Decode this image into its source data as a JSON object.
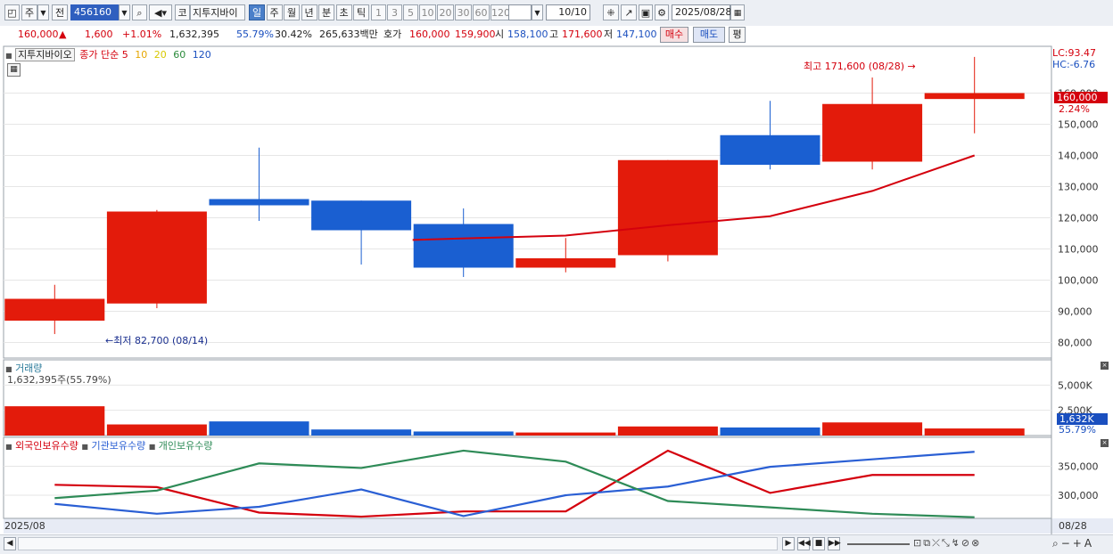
{
  "toolbar": {
    "type_label": "주",
    "prev_label": "전",
    "code": "456160",
    "stock_prefix": "코",
    "stock_name": "지투지바이",
    "periods": [
      "일",
      "주",
      "월",
      "년",
      "분",
      "초",
      "틱"
    ],
    "selected_period": "일",
    "intervals": [
      "1",
      "3",
      "5",
      "10",
      "20",
      "30",
      "60",
      "120"
    ],
    "count": "10/10",
    "date": "2025/08/28"
  },
  "quote": {
    "price": "160,000",
    "change": "1,600",
    "change_pct": "+1.01%",
    "volume": "1,632,395",
    "vol_ratio": "55.79%",
    "turnover_pct": "30.42%",
    "amount": "265,633백만",
    "hoga_label": "호가",
    "ask": "160,000",
    "bid": "159,900",
    "open_label": "시",
    "open": "158,100",
    "high_label": "고",
    "high": "171,600",
    "low_label": "저",
    "low": "147,100",
    "buy_label": "매수",
    "sell_label": "매도",
    "eval_label": "평"
  },
  "price_panel": {
    "stock_label": "지투지바이오",
    "legend_prefix": "종가 단순",
    "ma_periods": [
      "5",
      "10",
      "20",
      "60",
      "120"
    ],
    "ma_colors": [
      "#d4000d",
      "#e6a600",
      "#e6d200",
      "#2a8a3a",
      "#1a4fbf"
    ],
    "lc": "LC:93.47",
    "hc": "HC:-6.76",
    "current_tag": "160,000",
    "current_pct": "2.24%",
    "high_annot": "최고 171,600 (08/28)",
    "low_annot": "최저 82,700 (08/14)"
  },
  "volume_panel": {
    "title": "거래량",
    "value_text": "1,632,395주(55.79%)",
    "current_tag": "1,632K",
    "current_pct": "55.79%"
  },
  "holdings_panel": {
    "series_labels": [
      "외국인보유수량",
      "기관보유수량",
      "개인보유수량"
    ]
  },
  "x_axis": {
    "left_label": "2025/08",
    "right_label": "08/28"
  },
  "chart_data": [
    {
      "type": "candlestick",
      "ylim": [
        75000,
        175000
      ],
      "yticks": [
        80000,
        90000,
        100000,
        110000,
        120000,
        130000,
        140000,
        150000,
        160000
      ],
      "ytick_labels": [
        "80,000",
        "90,000",
        "100,000",
        "110,000",
        "120,000",
        "130,000",
        "140,000",
        "150,000",
        "160,000"
      ],
      "candles": [
        {
          "o": 87000,
          "h": 98500,
          "l": 82700,
          "c": 94000,
          "dir": "up"
        },
        {
          "o": 92500,
          "h": 122500,
          "l": 91000,
          "c": 122000,
          "dir": "up"
        },
        {
          "o": 126000,
          "h": 142500,
          "l": 119000,
          "c": 124000,
          "dir": "down"
        },
        {
          "o": 125500,
          "h": 125500,
          "l": 105000,
          "c": 116000,
          "dir": "down"
        },
        {
          "o": 118000,
          "h": 123000,
          "l": 101000,
          "c": 104000,
          "dir": "down"
        },
        {
          "o": 104000,
          "h": 113500,
          "l": 102500,
          "c": 107000,
          "dir": "up"
        },
        {
          "o": 108000,
          "h": 138500,
          "l": 106000,
          "c": 138500,
          "dir": "up"
        },
        {
          "o": 146500,
          "h": 157500,
          "l": 135500,
          "c": 137000,
          "dir": "down"
        },
        {
          "o": 138000,
          "h": 165000,
          "l": 135500,
          "c": 156500,
          "dir": "up"
        },
        {
          "o": 158100,
          "h": 171600,
          "l": 147100,
          "c": 160000,
          "dir": "up"
        }
      ],
      "ma5": [
        null,
        null,
        null,
        null,
        112900,
        114300,
        117600,
        120500,
        128600,
        140000
      ]
    },
    {
      "type": "bar",
      "series": [
        {
          "values": [
            2900,
            1100,
            1400,
            600,
            400,
            300,
            900,
            800,
            1300,
            700
          ],
          "dirs": [
            "up",
            "up",
            "down",
            "down",
            "down",
            "up",
            "up",
            "down",
            "up",
            "up"
          ]
        }
      ],
      "ylim": [
        0,
        7500
      ],
      "yticks": [
        2500,
        5000
      ],
      "ytick_labels": [
        "2,500K",
        "5,000K"
      ]
    },
    {
      "type": "line",
      "ylim": [
        260000,
        400000
      ],
      "yticks": [
        300000,
        350000
      ],
      "ytick_labels": [
        "300,000",
        "350,000"
      ],
      "series": [
        {
          "name": "외국인보유수량",
          "color": "#d4000d",
          "values": [
            318000,
            314000,
            270000,
            263000,
            272000,
            272000,
            377000,
            304000,
            335000,
            335000
          ]
        },
        {
          "name": "기관보유수량",
          "color": "#2a5fd4",
          "values": [
            285000,
            268000,
            280000,
            310000,
            264000,
            300000,
            315000,
            349000,
            362000,
            375000
          ]
        },
        {
          "name": "개인보유수량",
          "color": "#2e8b57",
          "values": [
            295000,
            308000,
            355000,
            347000,
            377000,
            358000,
            290000,
            279000,
            268000,
            262000
          ]
        }
      ]
    }
  ]
}
